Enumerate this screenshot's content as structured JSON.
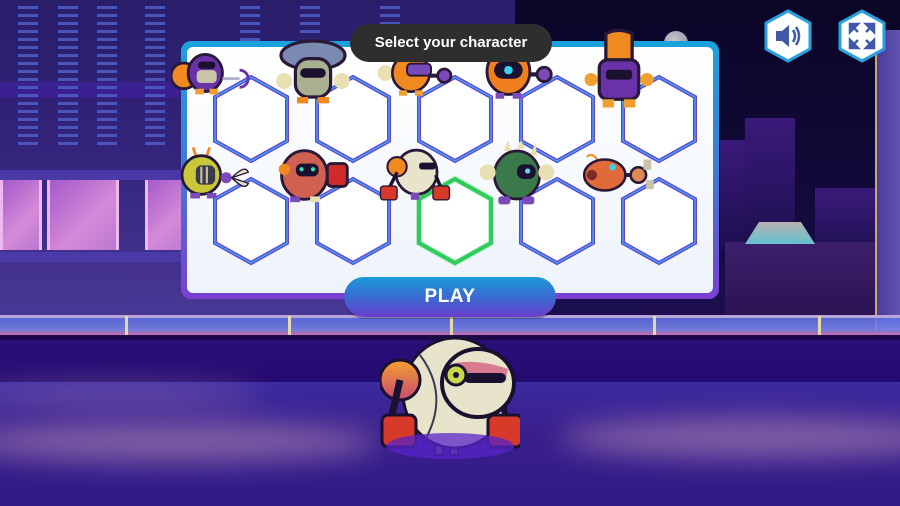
{
  "header": {
    "title": "Select your character"
  },
  "toolbar": {
    "sound_icon": "speaker-icon",
    "fullscreen_icon": "fullscreen-icon"
  },
  "characters": [
    {
      "id": 1,
      "name": "purple-shield-wrench-robot",
      "row": 1,
      "selected": false
    },
    {
      "id": 2,
      "name": "mushroom-hat-robot",
      "row": 1,
      "selected": false
    },
    {
      "id": 3,
      "name": "orange-visor-claw-robot",
      "row": 1,
      "selected": false
    },
    {
      "id": 4,
      "name": "orange-cyclops-claw-robot",
      "row": 1,
      "selected": false
    },
    {
      "id": 5,
      "name": "orange-tall-purple-robot",
      "row": 1,
      "selected": false
    },
    {
      "id": 6,
      "name": "yellow-diver-scissor-robot",
      "row": 2,
      "selected": false
    },
    {
      "id": 7,
      "name": "red-boxer-robot",
      "row": 2,
      "selected": false
    },
    {
      "id": 8,
      "name": "white-sphere-boxer-robot",
      "row": 2,
      "selected": true
    },
    {
      "id": 9,
      "name": "green-spiked-robot",
      "row": 2,
      "selected": false
    },
    {
      "id": 10,
      "name": "orange-fish-claw-robot",
      "row": 2,
      "selected": false
    }
  ],
  "play_button": {
    "label": "PLAY"
  },
  "preview": {
    "character": "white-sphere-boxer-robot"
  },
  "colors": {
    "selected_border": "#2ecc5a",
    "unselected_border": "#6a3fd0",
    "panel_gradient_top": "#1aa2dc",
    "panel_gradient_bottom": "#7a3fd0",
    "title_pill": "#2e2e2e"
  }
}
